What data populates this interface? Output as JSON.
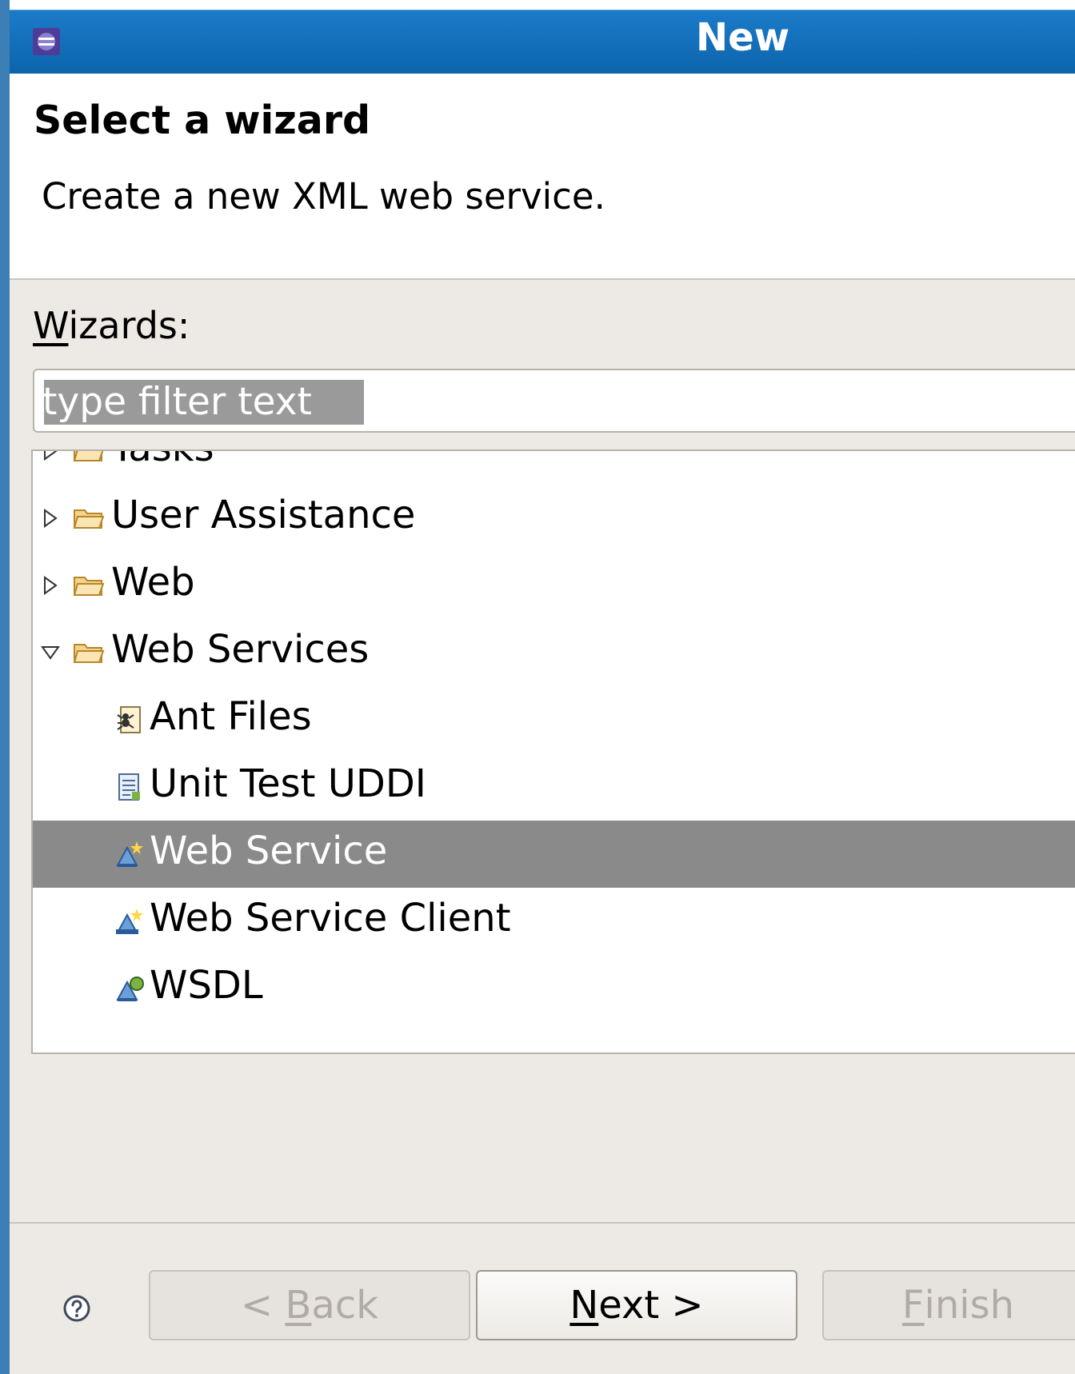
{
  "window": {
    "title": "New"
  },
  "header": {
    "title": "Select a wizard",
    "description": "Create a new XML web service."
  },
  "wizards": {
    "label_mnemonic": "W",
    "label_rest": "izards:",
    "filter_placeholder": "type filter text"
  },
  "tree": {
    "items": [
      {
        "label": "Tasks",
        "type": "folder",
        "expanded": false
      },
      {
        "label": "User Assistance",
        "type": "folder",
        "expanded": false
      },
      {
        "label": "Web",
        "type": "folder",
        "expanded": false
      },
      {
        "label": "Web Services",
        "type": "folder",
        "expanded": true
      },
      {
        "label": "Ant Files",
        "type": "item",
        "icon": "ant-file-icon"
      },
      {
        "label": "Unit Test UDDI",
        "type": "item",
        "icon": "uddi-page-icon"
      },
      {
        "label": "Web Service",
        "type": "item",
        "icon": "web-service-icon",
        "selected": true
      },
      {
        "label": "Web Service Client",
        "type": "item",
        "icon": "web-service-client-icon"
      },
      {
        "label": "WSDL",
        "type": "item",
        "icon": "wsdl-icon"
      }
    ]
  },
  "buttons": {
    "back_pre": "< ",
    "back_mnemonic": "B",
    "back_rest": "ack",
    "next_mnemonic": "N",
    "next_rest": "ext >",
    "finish_mnemonic": "F",
    "finish_rest": "inish"
  },
  "colors": {
    "titlebar": "#1271bd",
    "selection": "#8a8a8a",
    "dialog_bg": "#edeae5"
  }
}
